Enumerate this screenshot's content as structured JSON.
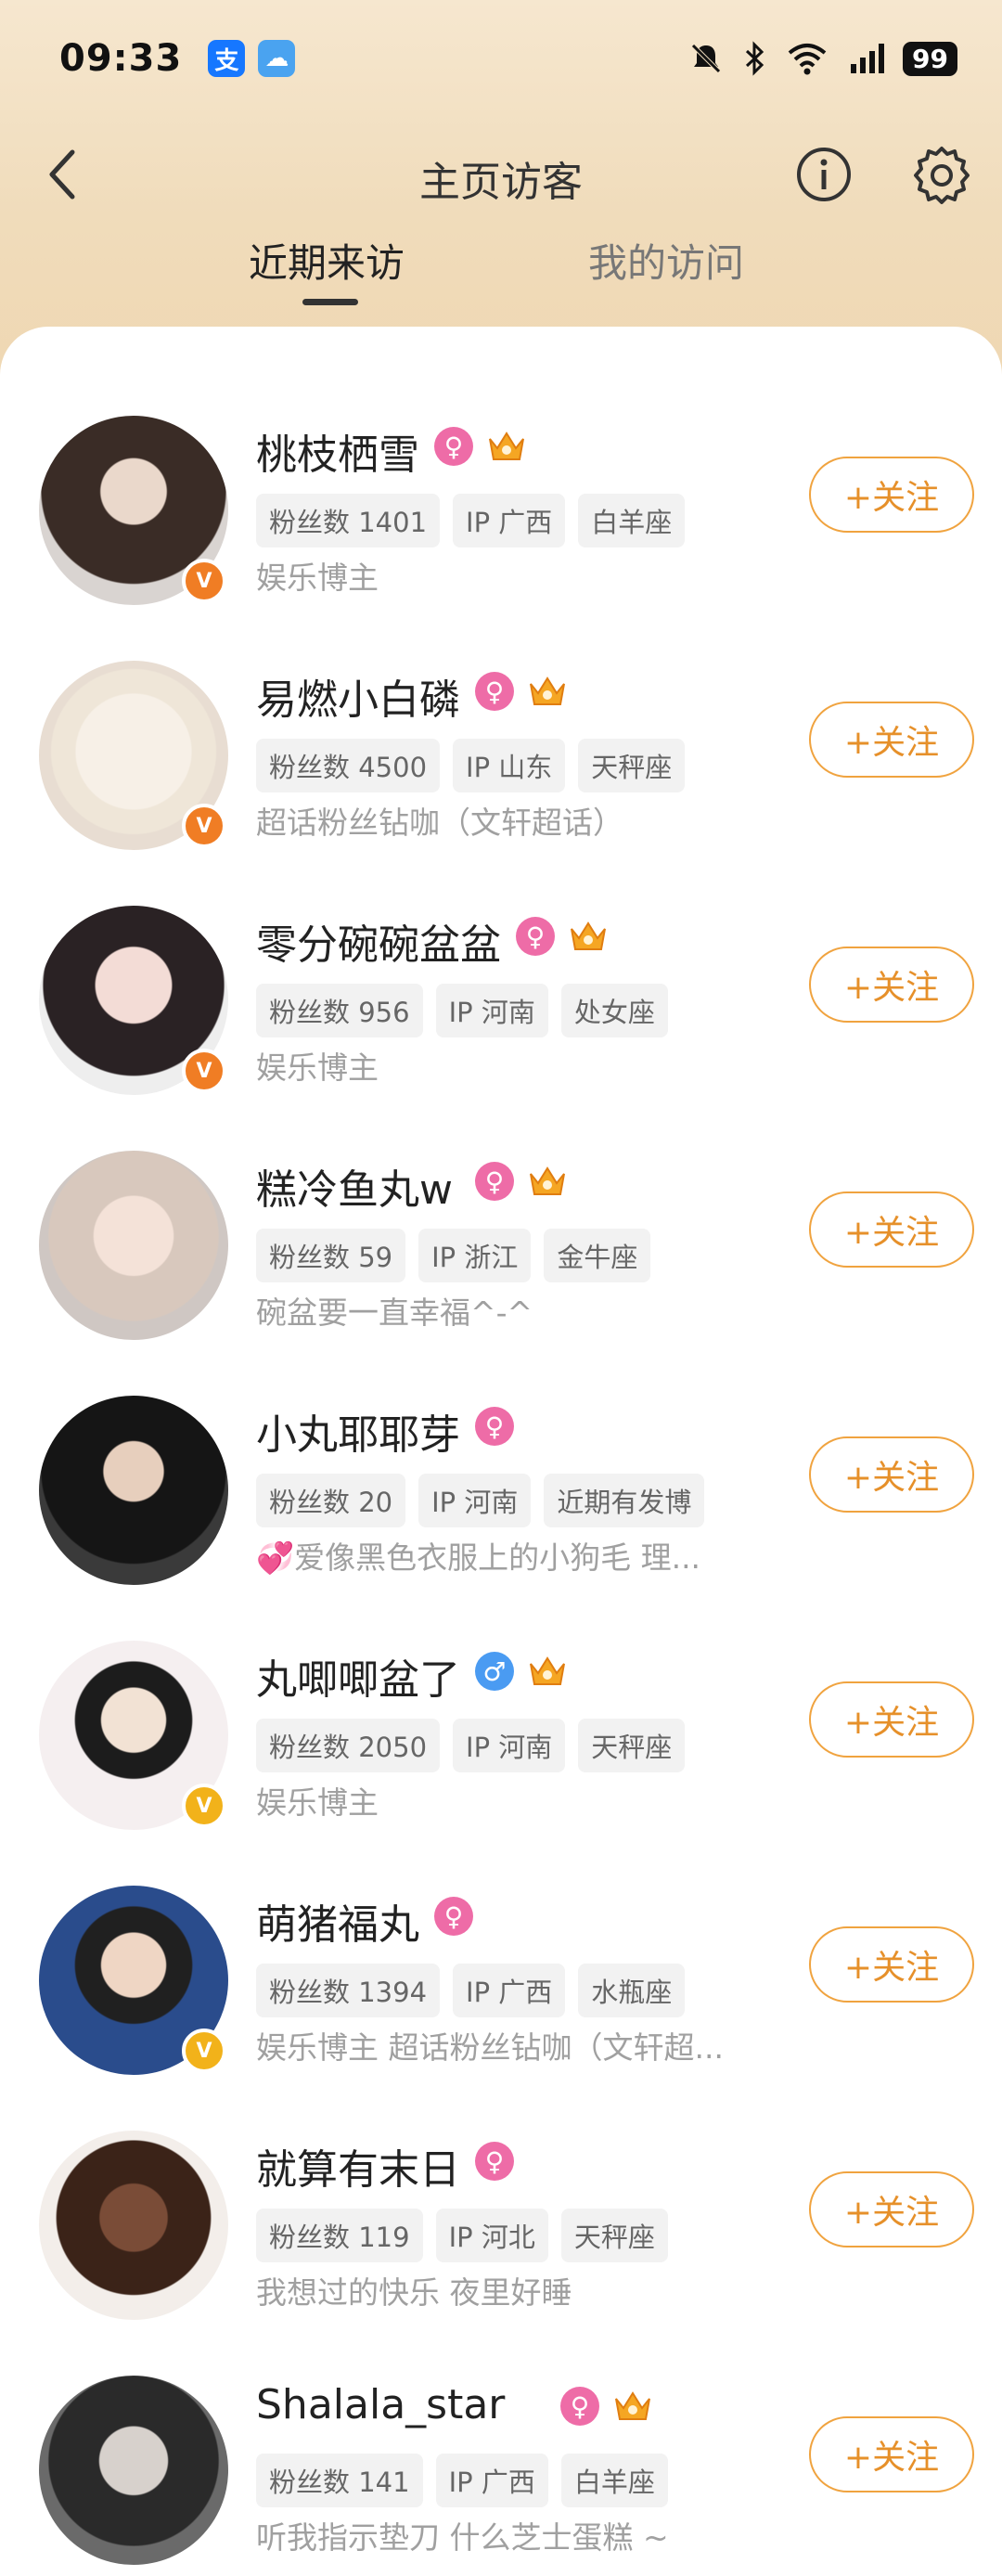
{
  "status_bar": {
    "time": "09:33",
    "battery": "99"
  },
  "header": {
    "title": "主页访客"
  },
  "tabs": [
    {
      "label": "近期来访"
    },
    {
      "label": "我的访问"
    }
  ],
  "follow_label": "+关注",
  "visitors": [
    {
      "name": "桃枝栖雪",
      "fans": "粉丝数 1401",
      "ip": "IP 广西",
      "extra": "白羊座",
      "desc": "娱乐博主",
      "gender": "female",
      "crown": true,
      "verified": "orange"
    },
    {
      "name": "易燃小白磷",
      "fans": "粉丝数 4500",
      "ip": "IP 山东",
      "extra": "天秤座",
      "desc": "超话粉丝钻咖（文轩超话）",
      "gender": "female",
      "crown": true,
      "verified": "orange"
    },
    {
      "name": "零分碗碗盆盆",
      "fans": "粉丝数 956",
      "ip": "IP 河南",
      "extra": "处女座",
      "desc": "娱乐博主",
      "gender": "female",
      "crown": true,
      "verified": "orange"
    },
    {
      "name": "糕冷鱼丸w",
      "fans": "粉丝数 59",
      "ip": "IP 浙江",
      "extra": "金牛座",
      "desc": "碗盆要一直幸福^-^",
      "gender": "female",
      "crown": true,
      "verified": ""
    },
    {
      "name": "小丸耶耶芽",
      "fans": "粉丝数 20",
      "ip": "IP 河南",
      "extra": "近期有发博",
      "desc": "💞爱像黑色衣服上的小狗毛 理...",
      "gender": "female",
      "crown": false,
      "verified": ""
    },
    {
      "name": "丸唧唧盆了",
      "fans": "粉丝数 2050",
      "ip": "IP 河南",
      "extra": "天秤座",
      "desc": "娱乐博主",
      "gender": "male",
      "crown": true,
      "verified": "yellow"
    },
    {
      "name": "萌猪福丸",
      "fans": "粉丝数 1394",
      "ip": "IP 广西",
      "extra": "水瓶座",
      "desc": "娱乐博主 超话粉丝钻咖（文轩超...",
      "gender": "female",
      "crown": false,
      "verified": "yellow"
    },
    {
      "name": "就算有末日",
      "fans": "粉丝数 119",
      "ip": "IP 河北",
      "extra": "天秤座",
      "desc": "我想过的快乐 夜里好睡",
      "gender": "female",
      "crown": false,
      "verified": ""
    },
    {
      "name": "Shalala_star",
      "fans": "粉丝数 141",
      "ip": "IP 广西",
      "extra": "白羊座",
      "desc": "听我指示垫刀 什么芝士蛋糕 ~",
      "gender": "female",
      "crown": true,
      "verified": ""
    }
  ]
}
